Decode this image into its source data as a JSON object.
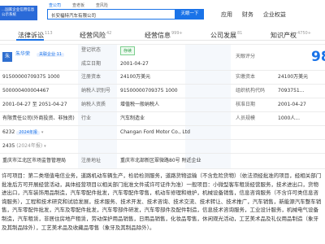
{
  "header": {
    "logo_text": "...国家企业信用信息公示系统",
    "search_tabs": [
      "查公司",
      "查老板",
      "查风险"
    ],
    "search_value": "长安福特汽车有限公司",
    "search_button": "天眼一下",
    "nav": [
      "应用",
      "财务",
      "企业权益"
    ]
  },
  "tabs": [
    {
      "label": "法律诉讼",
      "count": "113"
    },
    {
      "label": "经营风险",
      "count": "42"
    },
    {
      "label": "经营信息",
      "count": "999+"
    },
    {
      "label": "公司发展",
      "count": "81"
    },
    {
      "label": "知识产权",
      "count": "4750+"
    }
  ],
  "row1": {
    "legal_rep": "朱华荣",
    "legal_badge": "关联企业 11",
    "reg_status_label": "登记状态",
    "reg_status_value": "存续",
    "score_label": "天眼评分",
    "score_value": "98"
  },
  "row2": {
    "founded_label": "成立日期",
    "founded_value": "2001-04-27"
  },
  "row3": {
    "credit_code": "91500000709375 1000",
    "capital_label": "注册资本",
    "capital_value": "24100万美元",
    "paid_label": "实缴资本",
    "paid_value": "24100万美元"
  },
  "row4": {
    "reg_no": "500000400004467",
    "taxpayer_id_label": "纳税人识别号",
    "taxpayer_id_value": "91500000709375 1000",
    "org_code_label": "组织机构代码",
    "org_code_value": "7093751..."
  },
  "row5": {
    "term": "2001-04-27 至 2051-04-27",
    "taxpayer_q_label": "纳税人资质",
    "taxpayer_q_value": "增值税一般纳税人",
    "approve_label": "核准日期",
    "approve_value": "2001-04-27"
  },
  "row6": {
    "company_type": "有限责任公司(外商投资、非独资)",
    "industry_label": "行业",
    "industry_value": "汽车制造业",
    "staff_label": "人员规模",
    "staff_value": "1000人..."
  },
  "row7": {
    "insured": "6232",
    "insured_year": "2024年报",
    "en_name": "Changan Ford Motor Co., Ltd"
  },
  "row8": {
    "count": "2435",
    "count_year": "(2024年报)"
  },
  "row9": {
    "authority": "重庆市江北区市场监督管理局",
    "address_label": "注册地址",
    "address_value": "重庆市北部新区翠微路80号 附近企业"
  },
  "scope_text": "许可项目：第二类增值电信业务，道路机动车辆生产，检验检测服务，道路货物运输（不含危险货物）（依法须经批准的项目，经相关部门批准后方可开展经营活动，具体经营项目以相关部门批准文件或许可证件为准）一般项目：小微型客车租赁经营服务，技术进出口，货物进出口，汽车装饰用品制造，汽车零配件批发，汽车零配件零售，机动车修理和维护，机械设备销售，信息咨询服务（不含许可类信息咨询服务），工程和技术研究和试验发展，技术服务、技术开发、技术咨询、技术交流、技术转让、技术推广，汽车销售，新能源汽车整车销售，汽车零配件批发，汽车及零配件批发，汽车零部件研发，汽车零部件及配件制造，信息技术咨询服务，工业设计服务，机械电气设备制造，汽车租赁，非居住房地产租赁，劳动保护用品销售，日用品销售，化妆品零售，休闲观光活动，工艺美术品及礼仪用品制造（象牙及其制品除外），工艺美术品及收藏品零售（象牙及其制品除外）。"
}
